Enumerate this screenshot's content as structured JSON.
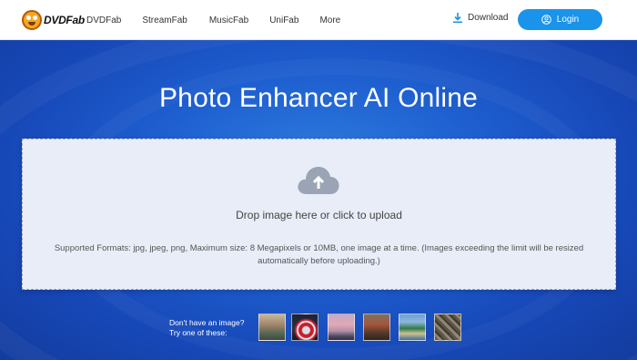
{
  "brand": {
    "name": "DVDFab"
  },
  "nav": {
    "items": [
      "DVDFab",
      "StreamFab",
      "MusicFab",
      "UniFab",
      "More"
    ]
  },
  "header": {
    "download_label": "Download",
    "login_label": "Login"
  },
  "hero": {
    "title": "Photo Enhancer AI Online"
  },
  "upload": {
    "drop_text": "Drop image here or click to upload",
    "formats_text": "Supported Formats: jpg, jpeg, png, Maximum size: 8 Megapixels or 10MB, one image at a time. (Images exceeding the limit will be resized automatically before uploading.)"
  },
  "samples": {
    "line1": "Don't have an image?",
    "line2": "Try one of these:",
    "items": [
      "sunset-landscape",
      "captain-america",
      "pink-sky",
      "historic-buildings",
      "beach-view",
      "city-aerial"
    ]
  },
  "colors": {
    "accent": "#1a93ea",
    "hero_blue": "#1e5fd0",
    "dropzone_bg": "#e8edf8"
  }
}
